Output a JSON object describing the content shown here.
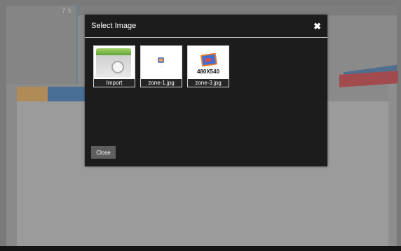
{
  "background": {
    "timer": "7 s"
  },
  "modal": {
    "title": "Select Image",
    "close_icon": "close-x-icon",
    "images": [
      {
        "caption": "Import",
        "icon": "import-image-icon"
      },
      {
        "caption": "zone-1.jpg",
        "icon": "image-icon"
      },
      {
        "caption": "zone-3.jpg",
        "icon": "image-icon",
        "label": "480X540"
      }
    ],
    "close_button": "Close"
  }
}
